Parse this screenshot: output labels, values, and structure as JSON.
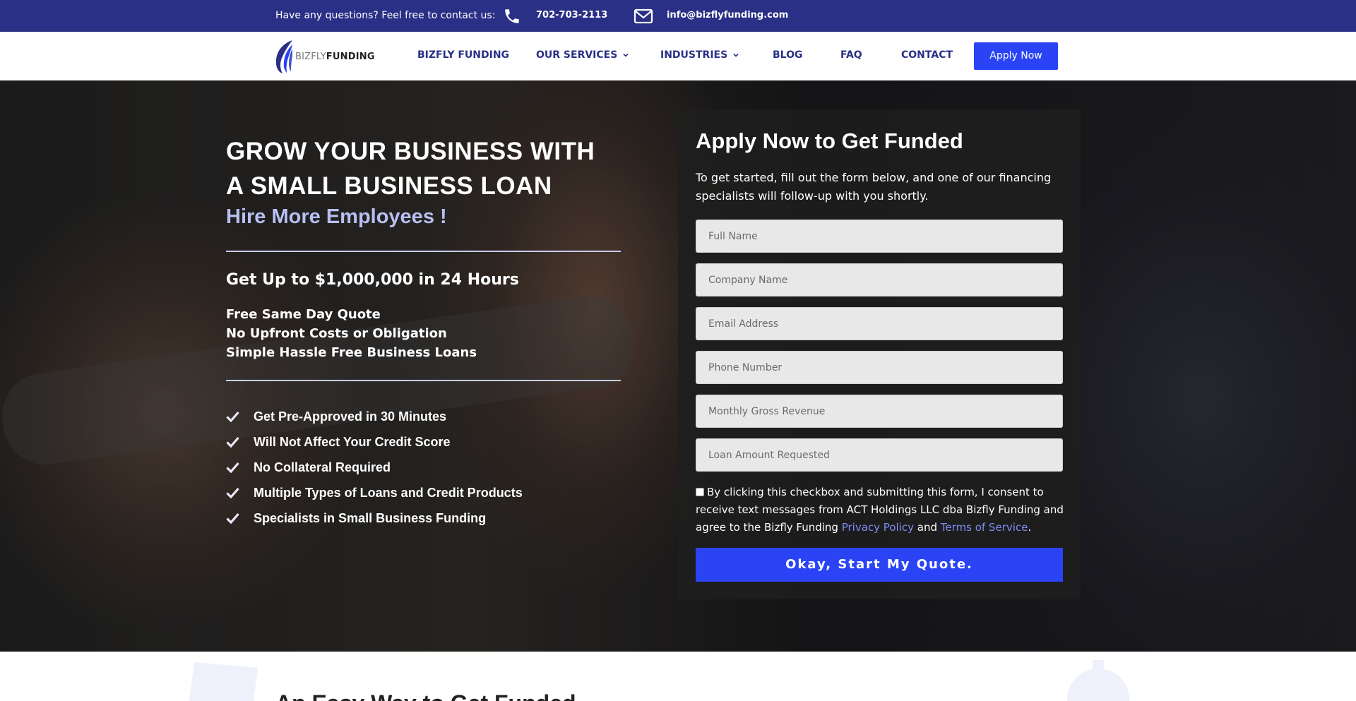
{
  "topbar": {
    "question": "Have any questions? Feel free to contact us:",
    "phone": "702-703-2113",
    "email": "info@bizflyfunding.com"
  },
  "nav": {
    "logo_light": "BIZFLY",
    "logo_bold": "FUNDING",
    "items": [
      {
        "label": "BIZFLY FUNDING",
        "dropdown": false
      },
      {
        "label": "OUR SERVICES",
        "dropdown": true
      },
      {
        "label": "INDUSTRIES",
        "dropdown": true
      },
      {
        "label": "BLOG",
        "dropdown": false
      },
      {
        "label": "FAQ",
        "dropdown": false
      },
      {
        "label": "CONTACT",
        "dropdown": false
      }
    ],
    "apply_label": "Apply Now"
  },
  "hero": {
    "headline_line1": "GROW YOUR BUSINESS WITH",
    "headline_line2": "A SMALL BUSINESS LOAN",
    "subhead": "Hire More Employees !",
    "amount": "Get Up to $1,000,000 in 24 Hours",
    "perks": [
      "Free Same Day Quote",
      "No Upfront Costs or Obligation",
      "Simple Hassle Free Business Loans"
    ],
    "checks": [
      "Get Pre-Approved in 30 Minutes",
      "Will Not Affect Your Credit Score",
      "No Collateral Required",
      "Multiple Types of Loans and Credit Products",
      "Specialists in Small Business Funding"
    ]
  },
  "form": {
    "title": "Apply Now to Get Funded",
    "intro": "To get started, fill out the form below, and one of our financing specialists will follow-up with you shortly.",
    "fields": [
      {
        "placeholder": "Full Name",
        "value": ""
      },
      {
        "placeholder": "Company Name",
        "value": ""
      },
      {
        "placeholder": "Email Address",
        "value": ""
      },
      {
        "placeholder": "Phone Number",
        "value": ""
      },
      {
        "placeholder": "Monthly Gross Revenue",
        "value": ""
      },
      {
        "placeholder": "Loan Amount Requested",
        "value": ""
      }
    ],
    "consent_text": "By clicking this checkbox and submitting this form, I consent to receive text messages from ACT Holdings LLC dba Bizfly Funding and agree to the Bizfly Funding",
    "privacy_link": "Privacy Policy",
    "and_text": "and",
    "terms_link": "Terms of Service",
    "period": ".",
    "submit_label": "Okay, Start My Quote."
  },
  "bottom": {
    "heading": "An Easy Way to Get Funded"
  },
  "colors": {
    "brand_navy": "#2a3085",
    "accent_blue": "#2a44f5",
    "link_blue": "#7d8df0",
    "subhead_lavender": "#b8bff2"
  },
  "icons": {
    "phone": "phone-icon",
    "mail": "mail-icon",
    "check": "check-icon",
    "chevron": "chevron-down-icon",
    "logo": "wing-logo-icon"
  }
}
